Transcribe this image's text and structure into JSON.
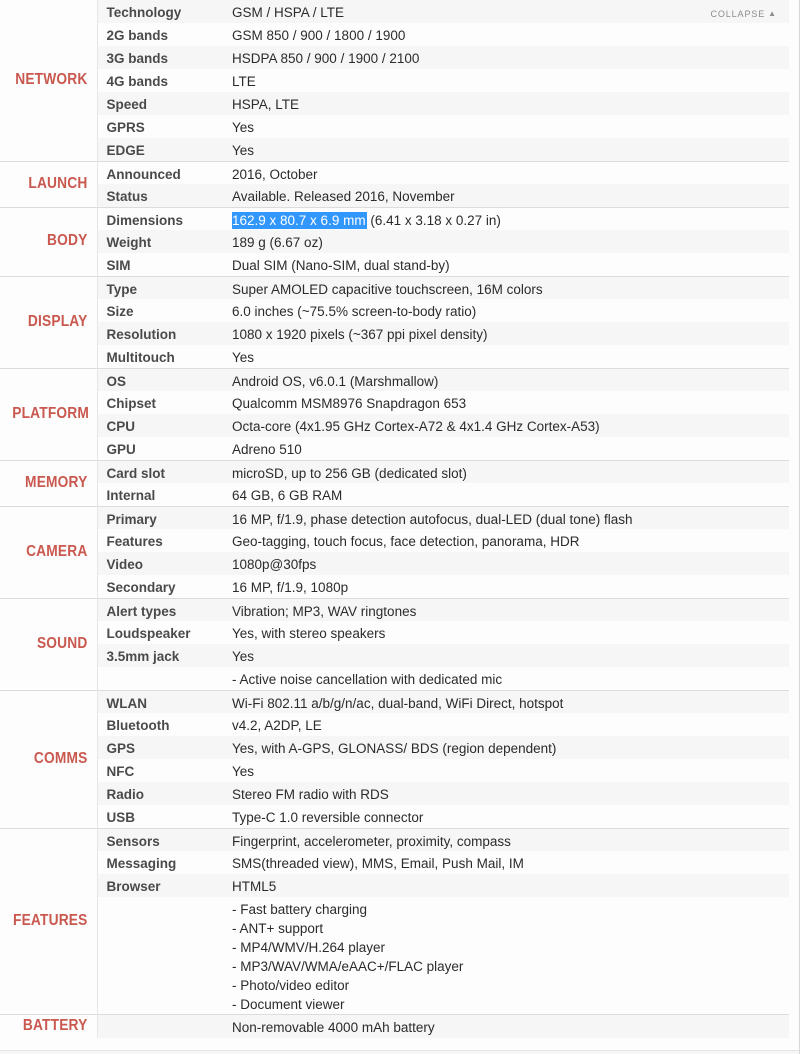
{
  "header": {
    "collapse_label": "COLLAPSE",
    "collapse_caret": "▲"
  },
  "colors": {
    "section_title": "#c9584f",
    "label_text": "#4a4a4a",
    "value_text": "#2b2b2b",
    "selection_bg": "#3297fd",
    "row_shade": "#f6f6f6",
    "row_plain": "#fdfdfd"
  },
  "sections": [
    {
      "name": "NETWORK",
      "rows": [
        {
          "label": "Technology",
          "value": "GSM / HSPA / LTE"
        },
        {
          "label": "2G bands",
          "value": "GSM 850 / 900 / 1800 / 1900"
        },
        {
          "label": "3G bands",
          "value": "HSDPA 850 / 900 / 1900 / 2100"
        },
        {
          "label": "4G bands",
          "value": "LTE"
        },
        {
          "label": "Speed",
          "value": "HSPA, LTE"
        },
        {
          "label": "GPRS",
          "value": "Yes"
        },
        {
          "label": "EDGE",
          "value": "Yes"
        }
      ]
    },
    {
      "name": "LAUNCH",
      "rows": [
        {
          "label": "Announced",
          "value": "2016, October"
        },
        {
          "label": "Status",
          "value": "Available. Released 2016, November"
        }
      ]
    },
    {
      "name": "BODY",
      "rows": [
        {
          "label": "Dimensions",
          "value_selected": "162.9 x 80.7 x 6.9 mm",
          "value_rest": " (6.41 x 3.18 x 0.27 in)"
        },
        {
          "label": "Weight",
          "value": "189 g (6.67 oz)"
        },
        {
          "label": "SIM",
          "value": "Dual SIM (Nano-SIM, dual stand-by)"
        }
      ]
    },
    {
      "name": "DISPLAY",
      "rows": [
        {
          "label": "Type",
          "value": "Super AMOLED capacitive touchscreen, 16M colors"
        },
        {
          "label": "Size",
          "value": "6.0 inches (~75.5% screen-to-body ratio)"
        },
        {
          "label": "Resolution",
          "value": "1080 x 1920 pixels (~367 ppi pixel density)"
        },
        {
          "label": "Multitouch",
          "value": "Yes"
        }
      ]
    },
    {
      "name": "PLATFORM",
      "rows": [
        {
          "label": "OS",
          "value": "Android OS, v6.0.1 (Marshmallow)"
        },
        {
          "label": "Chipset",
          "value": "Qualcomm MSM8976 Snapdragon 653"
        },
        {
          "label": "CPU",
          "value": "Octa-core (4x1.95 GHz Cortex-A72 & 4x1.4 GHz Cortex-A53)"
        },
        {
          "label": "GPU",
          "value": "Adreno 510"
        }
      ]
    },
    {
      "name": "MEMORY",
      "rows": [
        {
          "label": "Card slot",
          "value": "microSD, up to 256 GB (dedicated slot)"
        },
        {
          "label": "Internal",
          "value": "64 GB, 6 GB RAM"
        }
      ]
    },
    {
      "name": "CAMERA",
      "rows": [
        {
          "label": "Primary",
          "value": "16 MP, f/1.9, phase detection autofocus, dual-LED (dual tone) flash"
        },
        {
          "label": "Features",
          "value": "Geo-tagging, touch focus, face detection, panorama, HDR"
        },
        {
          "label": "Video",
          "value": "1080p@30fps"
        },
        {
          "label": "Secondary",
          "value": "16 MP, f/1.9, 1080p"
        }
      ]
    },
    {
      "name": "SOUND",
      "rows": [
        {
          "label": "Alert types",
          "value": "Vibration; MP3, WAV ringtones"
        },
        {
          "label": "Loudspeaker",
          "value": "Yes, with stereo speakers"
        },
        {
          "label": "3.5mm jack",
          "value": "Yes"
        },
        {
          "label": "",
          "value": "- Active noise cancellation with dedicated mic"
        }
      ]
    },
    {
      "name": "COMMS",
      "rows": [
        {
          "label": "WLAN",
          "value": "Wi-Fi 802.11 a/b/g/n/ac, dual-band, WiFi Direct, hotspot"
        },
        {
          "label": "Bluetooth",
          "value": "v4.2, A2DP, LE"
        },
        {
          "label": "GPS",
          "value": "Yes, with A-GPS, GLONASS/ BDS (region dependent)"
        },
        {
          "label": "NFC",
          "value": "Yes"
        },
        {
          "label": "Radio",
          "value": "Stereo FM radio with RDS"
        },
        {
          "label": "USB",
          "value": "Type-C 1.0 reversible connector"
        }
      ]
    },
    {
      "name": "FEATURES",
      "rows": [
        {
          "label": "Sensors",
          "value": "Fingerprint, accelerometer, proximity, compass"
        },
        {
          "label": "Messaging",
          "value": "SMS(threaded view), MMS, Email, Push Mail, IM"
        },
        {
          "label": "Browser",
          "value": "HTML5"
        },
        {
          "label": "",
          "value": "- Fast battery charging\n- ANT+ support\n- MP4/WMV/H.264 player\n- MP3/WAV/WMA/eAAC+/FLAC player\n- Photo/video editor\n- Document viewer",
          "multiline": true
        }
      ]
    },
    {
      "name": "BATTERY",
      "rows": [
        {
          "label": "",
          "value": "Non-removable 4000 mAh battery"
        }
      ]
    }
  ]
}
